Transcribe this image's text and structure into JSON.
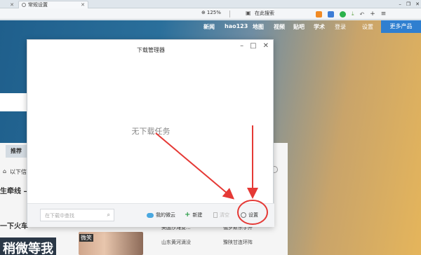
{
  "browser": {
    "tabs": [
      {
        "label": ""
      },
      {
        "label": "常规设置"
      }
    ],
    "zoom": "125%",
    "search_placeholder": "在此搜索",
    "toolbar_icons": [
      "video-icon",
      "bookmark-icon",
      "wechat-icon",
      "download-icon",
      "undo-icon",
      "new-tab-icon",
      "menu-icon"
    ],
    "toolbar_icon_colors": [
      "#f08a24",
      "#3c7dd6",
      "#2bb24c",
      "#6aa84f",
      "#666666",
      "#444444",
      "#444444"
    ]
  },
  "site": {
    "nav": [
      "新闻",
      "hao123",
      "地图",
      "视频",
      "贴吧",
      "学术",
      "登录",
      "设置"
    ],
    "more_products": "更多产品",
    "recommend_tab": "推荐",
    "left_text_1": "以下信",
    "left_text_2": "生牵线 —",
    "left_text_3": "一下火车",
    "big_text": "稍微等我",
    "photo_tag": "微笑",
    "news": [
      "美国沙滩变...",
      "俄罗斯杀手开",
      "山东黄河滴没",
      "豫陕甘连环阵"
    ]
  },
  "dialog": {
    "title": "下载管理器",
    "empty_message": "无下载任务",
    "search_placeholder": "在下载中查找",
    "buttons": {
      "my_cloud": "我的微云",
      "new": "新建",
      "delete": "清空",
      "settings": "设置"
    }
  },
  "colors": {
    "annotation": "#e53935",
    "more_button": "#2f7fd0"
  }
}
